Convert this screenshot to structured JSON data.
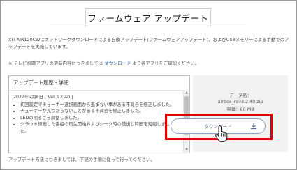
{
  "page": {
    "title": "ファームウェア アップデート",
    "description": "XIT-AIR120CWはネットワークダウンロードによる自動アップデート(ファームウェアアップデート)、およびUSBメモリーによる手動でのアップデートを実施しています。",
    "notice_prefix": "※ テレビ視聴アプリの更新内容につきましては",
    "notice_link": "ダウンロード",
    "notice_suffix": "より各アプリをご確認ください。",
    "footer": "アップデート方法につきましては、下記の手順に従って行ってください。"
  },
  "history": {
    "heading": "アップデート履歴・詳細",
    "date": "2022年2月8日 [ Ver.3.2.40 ]",
    "items": [
      "初回設定でチューナー選択画面から進まない事がある不具合を修正しました。",
      "チューナーが見つからないことがある不具合を修正しました。",
      "LEDの明るさを調整しました。",
      "クラウド録画した番組の再生開始およびシーク時の読出し時間を短縮しました。"
    ]
  },
  "file": {
    "label": "データ名：",
    "name": "airbox_rev3.2.40.zip",
    "size": "容量：60 MB",
    "download_label": "ダウンロード"
  },
  "colors": {
    "highlight": "#e20000",
    "button_border": "#8aa3c9",
    "link": "#2a5fb5"
  },
  "icons": [
    "download-icon",
    "hand-pointer-icon",
    "scroll-up-icon",
    "scroll-down-icon"
  ]
}
